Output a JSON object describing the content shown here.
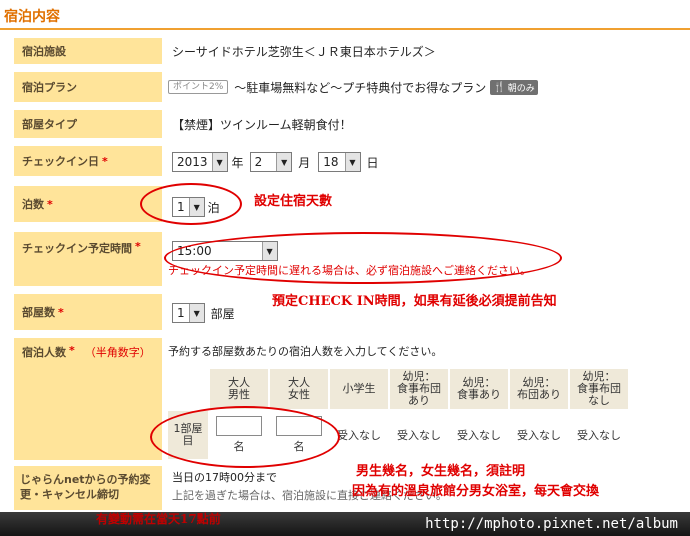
{
  "section_title": "宿泊内容",
  "rows": {
    "facility": {
      "label": "宿泊施設",
      "value": "シーサイドホテル芝弥生＜ＪＲ東日本ホテルズ＞"
    },
    "plan": {
      "label": "宿泊プラン",
      "point_badge": "ポイント2%",
      "value": "～駐車場無料など～プチ特典付でお得なプラン",
      "meal_badge": "朝のみ"
    },
    "room_type": {
      "label": "部屋タイプ",
      "value": "【禁煙】ツインルーム軽朝食付！"
    },
    "checkin_date": {
      "label": "チェックイン日",
      "required": "*",
      "year": "2013",
      "year_unit": "年",
      "month": "2",
      "month_unit": "月",
      "day": "18",
      "day_unit": "日"
    },
    "nights": {
      "label": "泊数",
      "required": "*",
      "value": "1",
      "unit": "泊"
    },
    "checkin_time": {
      "label": "チェックイン予定時間",
      "required": "*",
      "value": "15:00",
      "warning": "チェックイン予定時間に遅れる場合は、必ず宿泊施設へご連絡ください。"
    },
    "rooms": {
      "label": "部屋数",
      "required": "*",
      "value": "1",
      "unit": "部屋"
    },
    "guests": {
      "label": "宿泊人数",
      "required": "*",
      "hint": "（半角数字）",
      "instruction": "予約する部屋数あたりの宿泊人数を入力してください。",
      "columns": [
        "大人\n男性",
        "大人\n女性",
        "小学生",
        "幼児：\n食事布団\nあり",
        "幼児：\n食事あり",
        "幼児：\n布団あり",
        "幼児：\n食事布団\nなし"
      ],
      "row_label": "1部屋\n目",
      "unit": "名",
      "not_accepted": "受入なし"
    },
    "deadline": {
      "label": "じゃらんnetからの予約変更・キャンセル締切",
      "line1": "当日の17時00分まで",
      "line2": "上記を過ぎた場合は、宿泊施設に直接ご連絡ください。"
    }
  },
  "annotations": {
    "nights_note": "設定住宿天數",
    "checkin_note": "預定CHECK IN時間，如果有延後必須提前告知",
    "guests_note1": "男生幾名，女生幾名，須註明",
    "guests_note2": "因為有的溫泉旅館分男女浴室，每天會交換",
    "deadline_note": "有變動需在當天17點前"
  },
  "footer_url": "http://mphoto.pixnet.net/album",
  "colors": {
    "label_bg": "#ffe49a",
    "title": "#e07000",
    "annotation": "#e00000",
    "table_header_bg": "#efe9d9"
  }
}
